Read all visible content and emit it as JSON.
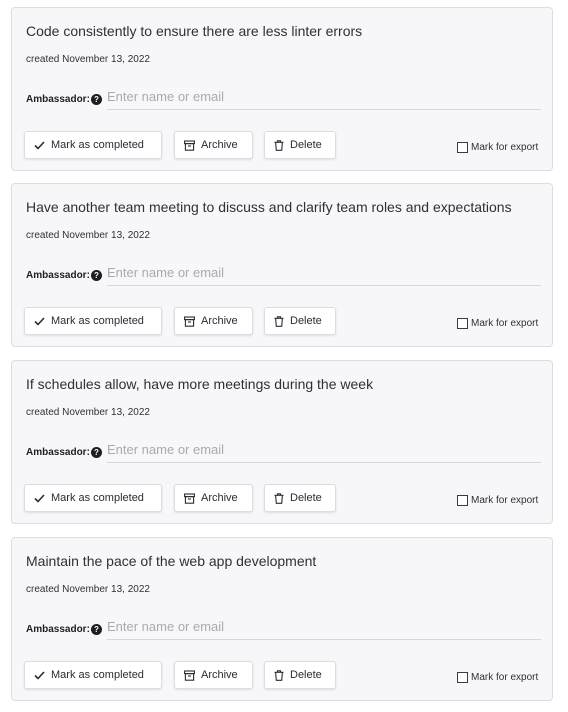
{
  "labels": {
    "ambassador": "Ambassador:",
    "help_glyph": "?",
    "ambassador_placeholder": "Enter name or email",
    "mark_completed": "Mark as completed",
    "archive": "Archive",
    "delete": "Delete",
    "mark_export": "Mark for export"
  },
  "icons": {
    "complete": "check-icon",
    "archive": "archive-box-icon",
    "delete": "trash-icon",
    "help": "question-circle-icon"
  },
  "items": [
    {
      "title": "Code consistently to ensure there are less linter errors",
      "created": "created November 13, 2022",
      "ambassador_value": "",
      "export_checked": false
    },
    {
      "title": "Have another team meeting to discuss and clarify team roles and expectations",
      "created": "created November 13, 2022",
      "ambassador_value": "",
      "export_checked": false
    },
    {
      "title": "If schedules allow, have more meetings during the week",
      "created": "created November 13, 2022",
      "ambassador_value": "",
      "export_checked": false
    },
    {
      "title": "Maintain the pace of the web app development",
      "created": "created November 13, 2022",
      "ambassador_value": "",
      "export_checked": false
    }
  ]
}
